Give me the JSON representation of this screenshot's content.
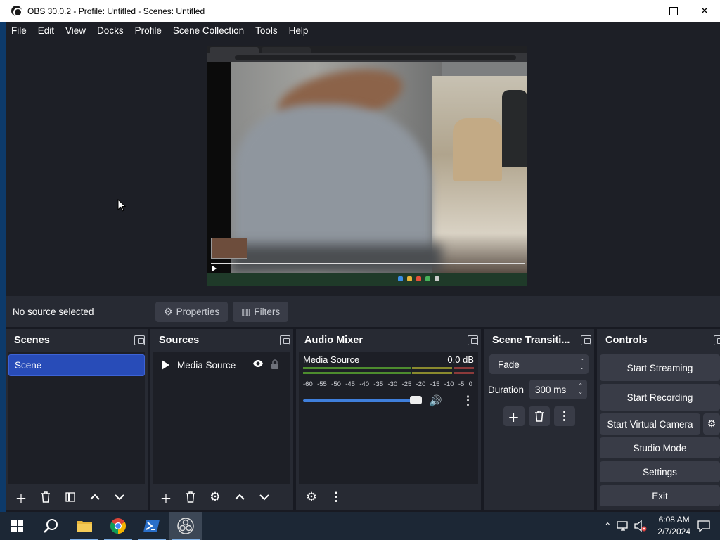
{
  "window": {
    "title": "OBS 30.0.2 - Profile: Untitled - Scenes: Untitled",
    "minimize_label": "",
    "close_label": "✕"
  },
  "menu": [
    "File",
    "Edit",
    "View",
    "Docks",
    "Profile",
    "Scene Collection",
    "Tools",
    "Help"
  ],
  "source_toolbar": {
    "status": "No source selected",
    "properties_label": "Properties",
    "filters_label": "Filters"
  },
  "scenes": {
    "title": "Scenes",
    "items": [
      "Scene"
    ]
  },
  "sources": {
    "title": "Sources",
    "items": [
      {
        "name": "Media Source",
        "visible": true,
        "locked": false
      }
    ]
  },
  "audio_mixer": {
    "title": "Audio Mixer",
    "channel": "Media Source",
    "level": "0.0 dB",
    "ticks": [
      "-60",
      "-55",
      "-50",
      "-45",
      "-40",
      "-35",
      "-30",
      "-25",
      "-20",
      "-15",
      "-10",
      "-5",
      "0"
    ],
    "volume": 1.0
  },
  "scene_transitions": {
    "title": "Scene Transiti...",
    "transition": "Fade",
    "duration_label": "Duration",
    "duration_value": "300 ms"
  },
  "controls": {
    "title": "Controls",
    "start_streaming": "Start Streaming",
    "start_recording": "Start Recording",
    "start_virtual_camera": "Start Virtual Camera",
    "studio_mode": "Studio Mode",
    "settings": "Settings",
    "exit": "Exit"
  },
  "taskbar": {
    "time": "6:08 AM",
    "date": "2/7/2024"
  },
  "colors": {
    "accent": "#284cb8",
    "panel": "#272a33",
    "background": "#1d1f26",
    "fader": "#3f7fdc"
  }
}
